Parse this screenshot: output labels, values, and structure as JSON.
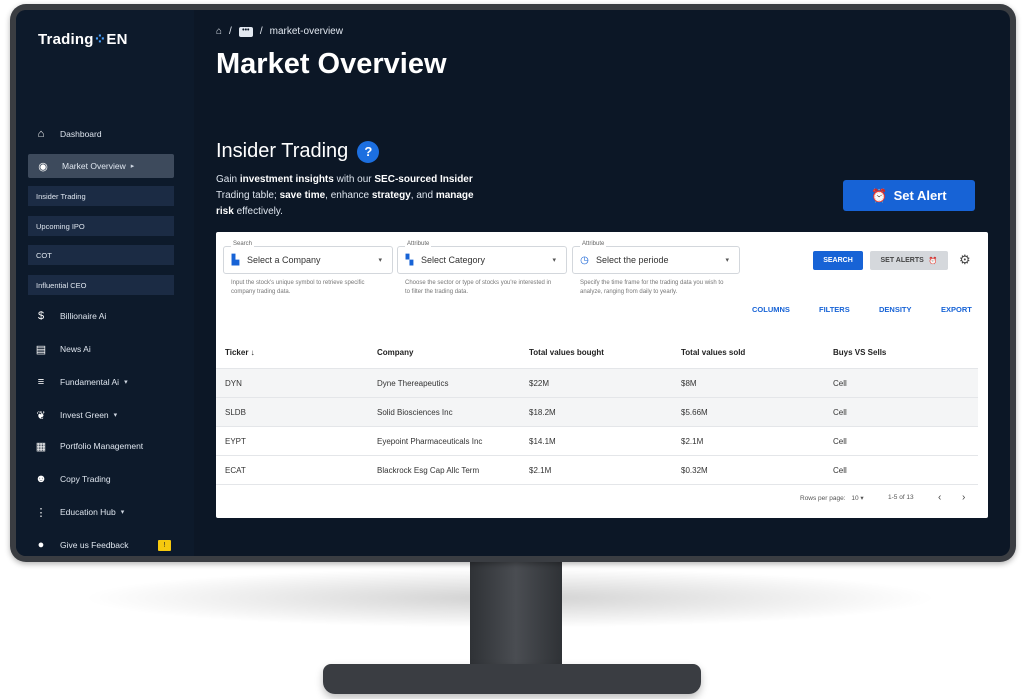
{
  "sidebar": {
    "logo_left": "Trading",
    "logo_right": "EN",
    "items": [
      {
        "label": "Dashboard",
        "icon": "home-icon"
      },
      {
        "label": "Market Overview",
        "icon": "eye-icon"
      },
      {
        "label": "Billionaire Ai",
        "icon": "dollar-icon"
      },
      {
        "label": "News Ai",
        "icon": "news-icon"
      },
      {
        "label": "Fundamental Ai",
        "icon": "list-icon"
      },
      {
        "label": "Invest Green",
        "icon": "leaf-icon"
      },
      {
        "label": "Portfolio Management",
        "icon": "grid-icon"
      },
      {
        "label": "Copy Trading",
        "icon": "users-icon"
      },
      {
        "label": "Education Hub",
        "icon": "education-icon"
      },
      {
        "label": "Give us Feedback",
        "icon": "chat-icon"
      }
    ],
    "subitems": [
      "Insider Trading",
      "Upcoming IPO",
      "COT",
      "Influential CEO"
    ],
    "feedback_badge": "!"
  },
  "breadcrumb": {
    "current": "market-overview",
    "dots": "•••"
  },
  "page_title": "Market Overview",
  "section": {
    "title": "Insider Trading",
    "help": "?",
    "intro_1": "Gain ",
    "intro_b1": "investment insights",
    "intro_2": " with our ",
    "intro_b2": "SEC-sourced Insider",
    "intro_3": " Trading table; ",
    "intro_b3": "save time",
    "intro_4": ", enhance ",
    "intro_b4": "strategy",
    "intro_5": ", and ",
    "intro_b5": "manage risk",
    "intro_6": " effectively."
  },
  "set_alert_label": "Set Alert",
  "filters": {
    "search": {
      "label": "Search",
      "value": "Select a Company",
      "hint": "Input the stock's unique symbol to retrieve specific company trading data."
    },
    "attribute": {
      "label": "Attribute",
      "value": "Select Category",
      "hint": "Choose the sector or type of stocks you're interested in to filter the trading data."
    },
    "period": {
      "label": "Attribute",
      "value": "Select the periode",
      "hint": "Specify the time frame for the trading data you wish to analyze, ranging from daily to yearly."
    },
    "search_button": "SEARCH",
    "set_alerts_button": "SET ALERTS"
  },
  "toolbar": {
    "columns": "COLUMNS",
    "filters": "FILTERS",
    "density": "DENSITY",
    "export": "EXPORT"
  },
  "table": {
    "headers": [
      "Ticker",
      "Company",
      "Total values bought",
      "Total values sold",
      "Buys VS Sells"
    ],
    "sort_arrow": "↓",
    "rows": [
      [
        "DYN",
        "Dyne Thereapeutics",
        "$22M",
        "$8M",
        "Cell"
      ],
      [
        "SLDB",
        "Solid Biosciences Inc",
        "$18.2M",
        "$5.66M",
        "Cell"
      ],
      [
        "EYPT",
        "Eyepoint Pharmaceuticals Inc",
        "$14.1M",
        "$2.1M",
        "Cell"
      ],
      [
        "ECAT",
        "Blackrock Esg Cap Allc Term",
        "$2.1M",
        "$0.32M",
        "Cell"
      ]
    ]
  },
  "pagination": {
    "rows_label": "Rows per page:",
    "rows_value": "10",
    "range": "1-5 of 13"
  }
}
